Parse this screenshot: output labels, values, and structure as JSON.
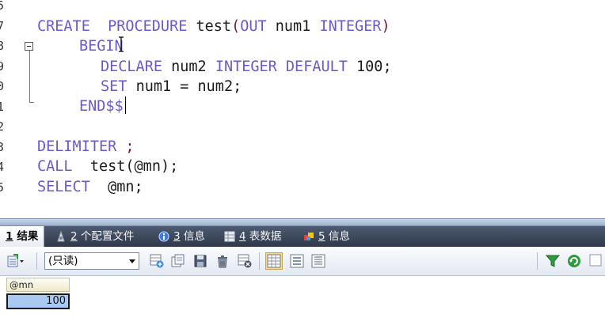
{
  "editor": {
    "line_numbers": [
      "5",
      "7",
      "8",
      "9",
      "0",
      "1",
      "2",
      "3",
      "4",
      "5"
    ],
    "code": {
      "create": "CREATE",
      "procedure": "PROCEDURE",
      "proc_name": "test",
      "open_paren": "(",
      "out": "OUT",
      "param": "num1",
      "integer1": "INTEGER",
      "close_paren": ")",
      "begin": "BEGIN",
      "declare": "DECLARE",
      "var": "num2",
      "integer2": "INTEGER",
      "default": "DEFAULT",
      "default_value": "100;",
      "set": "SET",
      "set_expr": "num1 = num2;",
      "end": "END$$",
      "delimiter": "DELIMITER",
      "delimiter_char": ";",
      "call": "CALL",
      "call_expr_name": "test",
      "call_expr_args": "(@mn);",
      "select": "SELECT",
      "select_expr": "@mn;"
    }
  },
  "tabs": [
    {
      "num": "1",
      "label": "结果",
      "icon": "result-icon"
    },
    {
      "num": "2",
      "label": "个配置文件",
      "icon": "profile-icon"
    },
    {
      "num": "3",
      "label": "信息",
      "icon": "info-icon"
    },
    {
      "num": "4",
      "label": "表数据",
      "icon": "table-data-icon"
    },
    {
      "num": "5",
      "label": "信息",
      "icon": "messages-icon"
    }
  ],
  "toolbar": {
    "mode_value": "(只读)"
  },
  "result": {
    "column": "@mn",
    "value": "100"
  },
  "colors": {
    "keyword": "#6a5acd",
    "punctuation": "#7a1630",
    "tabbar": "#3b4558",
    "cell_selected": "#a8c9f2"
  }
}
